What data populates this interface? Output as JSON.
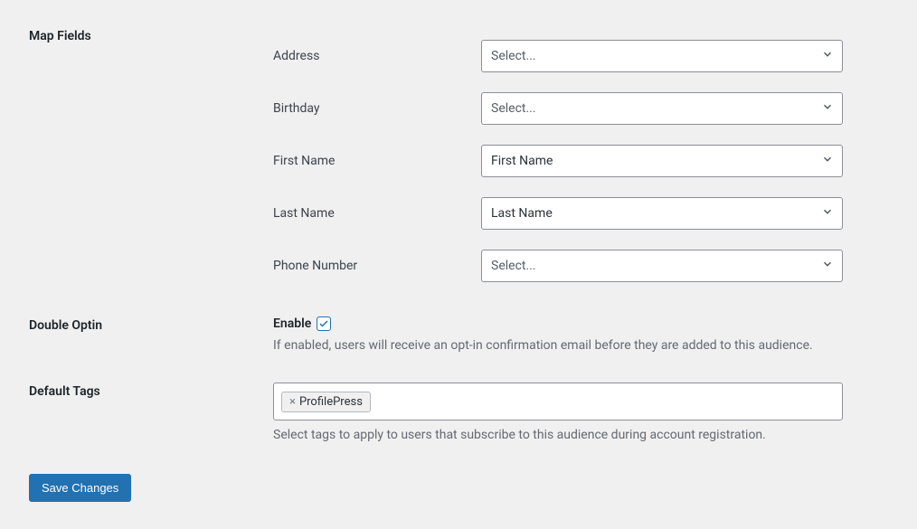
{
  "sections": {
    "mapFields": {
      "label": "Map Fields",
      "rows": {
        "address": {
          "label": "Address",
          "value": "Select..."
        },
        "birthday": {
          "label": "Birthday",
          "value": "Select..."
        },
        "firstName": {
          "label": "First Name",
          "value": "First Name"
        },
        "lastName": {
          "label": "Last Name",
          "value": "Last Name"
        },
        "phoneNumber": {
          "label": "Phone Number",
          "value": "Select..."
        }
      }
    },
    "doubleOptin": {
      "label": "Double Optin",
      "enableLabel": "Enable",
      "helpText": "If enabled, users will receive an opt-in confirmation email before they are added to this audience."
    },
    "defaultTags": {
      "label": "Default Tags",
      "tags": {
        "profilePress": "ProfilePress"
      },
      "helpText": "Select tags to apply to users that subscribe to this audience during account registration."
    }
  },
  "actions": {
    "saveLabel": "Save Changes"
  }
}
